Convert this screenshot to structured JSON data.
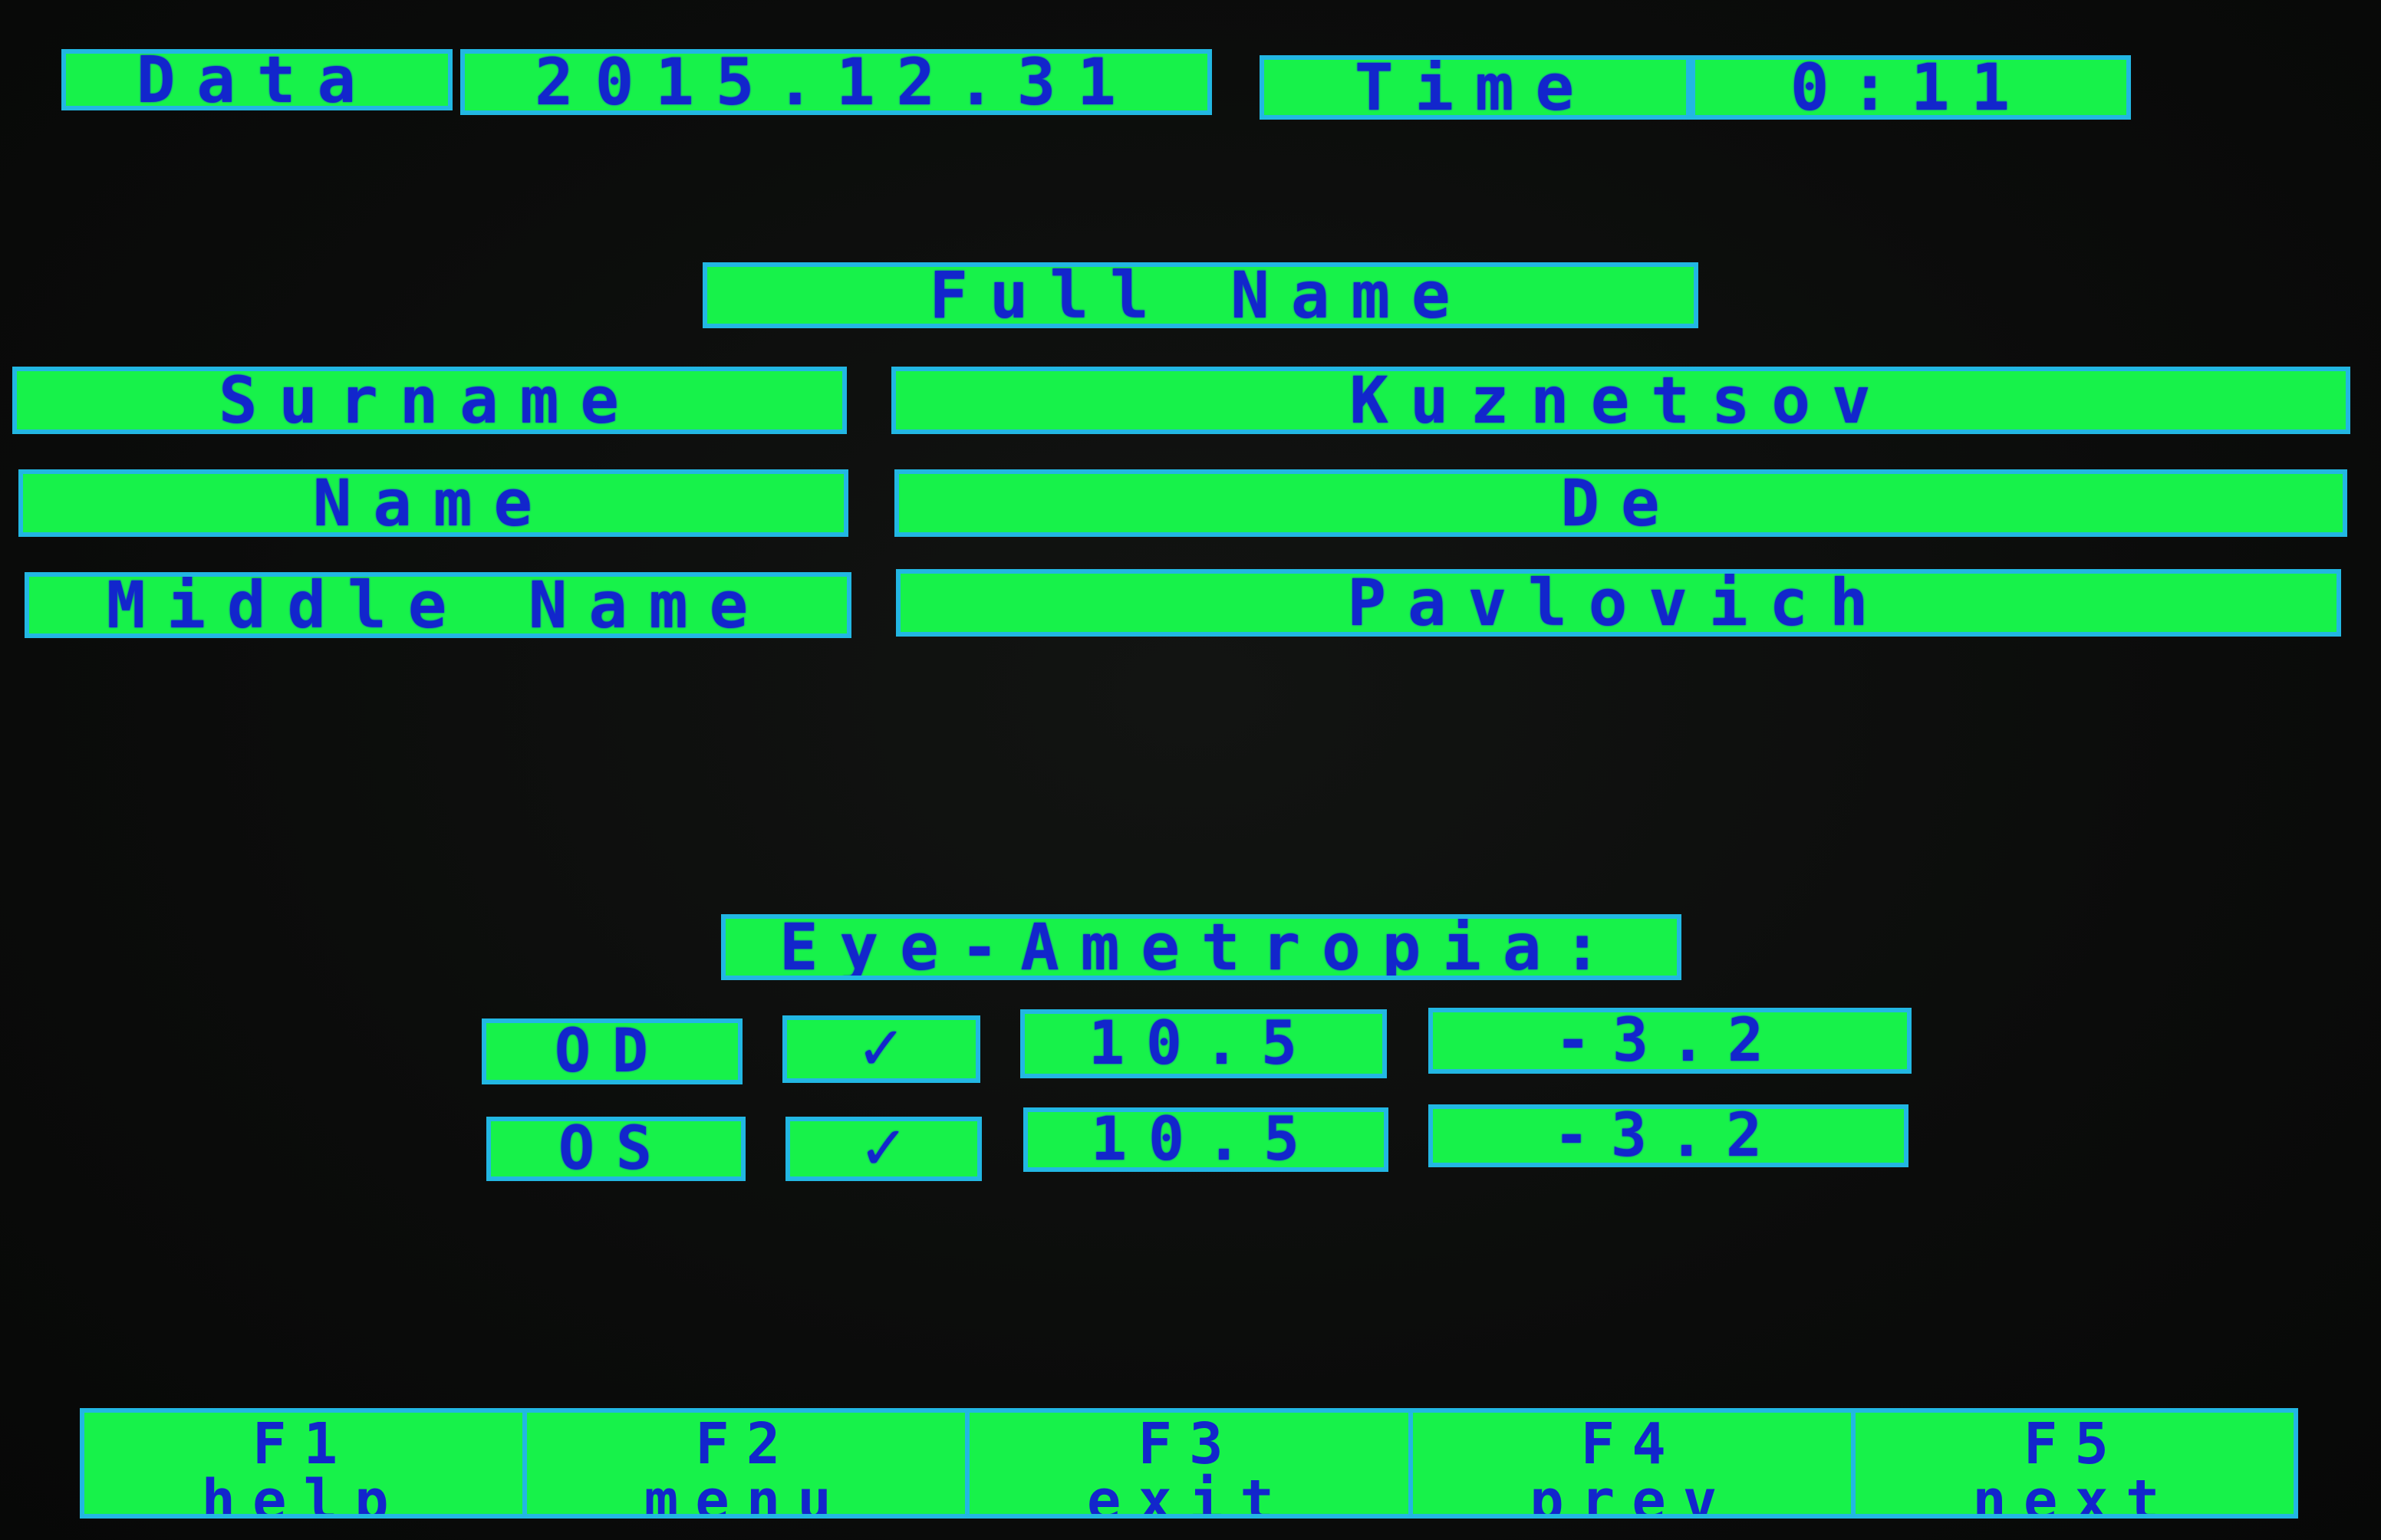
{
  "header": {
    "date_label": "Data",
    "date_value": "2015.12.31",
    "time_label": "Time",
    "time_value": "0:11"
  },
  "full_name": {
    "title": "Full Name",
    "surname_label": "Surname",
    "surname_value": "Kuznetsov",
    "name_label": "Name",
    "name_value": "De",
    "middle_label": "Middle Name",
    "middle_value": "Pavlovich"
  },
  "ametropia": {
    "title": "Eye-Ametropia:",
    "rows": [
      {
        "eye": "OD",
        "check": "✓",
        "value1": "10.5",
        "value2": "-3.2"
      },
      {
        "eye": "OS",
        "check": "✓",
        "value1": "10.5",
        "value2": "-3.2"
      }
    ]
  },
  "function_keys": [
    {
      "key": "F1",
      "label": "help"
    },
    {
      "key": "F2",
      "label": "menu"
    },
    {
      "key": "F3",
      "label": "exit"
    },
    {
      "key": "F4",
      "label": "prev"
    },
    {
      "key": "F5",
      "label": "next"
    }
  ],
  "colors": {
    "field_fill": "#17f24a",
    "field_border": "#22b7e3",
    "text": "#1226cc",
    "background": "#0a0b0a"
  }
}
